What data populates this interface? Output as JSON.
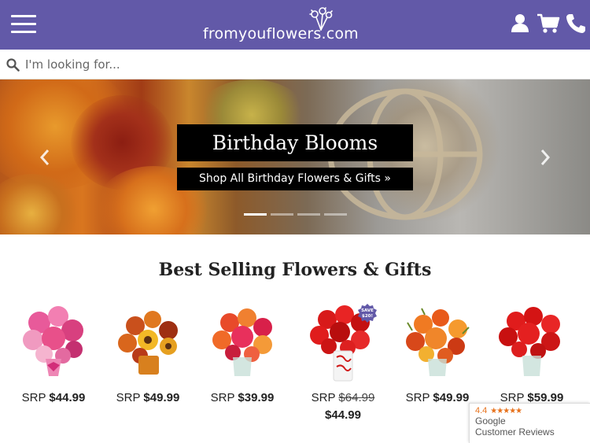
{
  "header": {
    "logo_text": "fromyouflowers.com",
    "menu_icon": "hamburger-menu-icon",
    "account_icon": "user-icon",
    "cart_icon": "cart-icon",
    "phone_icon": "phone-icon",
    "colors": {
      "header_bg": "#6259a8"
    }
  },
  "search": {
    "placeholder": "I'm looking for..."
  },
  "hero": {
    "title": "Birthday Blooms",
    "cta": "Shop All Birthday Flowers & Gifts »",
    "slides_count": 4,
    "active_slide": 1
  },
  "section": {
    "title": "Best Selling Flowers & Gifts"
  },
  "products": [
    {
      "srp_label": "SRP",
      "price": "$44.99"
    },
    {
      "srp_label": "SRP",
      "price": "$49.99"
    },
    {
      "srp_label": "SRP",
      "price": "$39.99"
    },
    {
      "srp_label": "SRP",
      "original_price": "$64.99",
      "sale_price": "$44.99",
      "badge_line1": "SAVE",
      "badge_line2": "$20!"
    },
    {
      "srp_label": "SRP",
      "price": "$49.99"
    },
    {
      "srp_label": "SRP",
      "price": "$59.99"
    }
  ],
  "reviews": {
    "rating": "4.4",
    "stars": "★★★★★",
    "line1": "Google",
    "line2": "Customer Reviews"
  }
}
